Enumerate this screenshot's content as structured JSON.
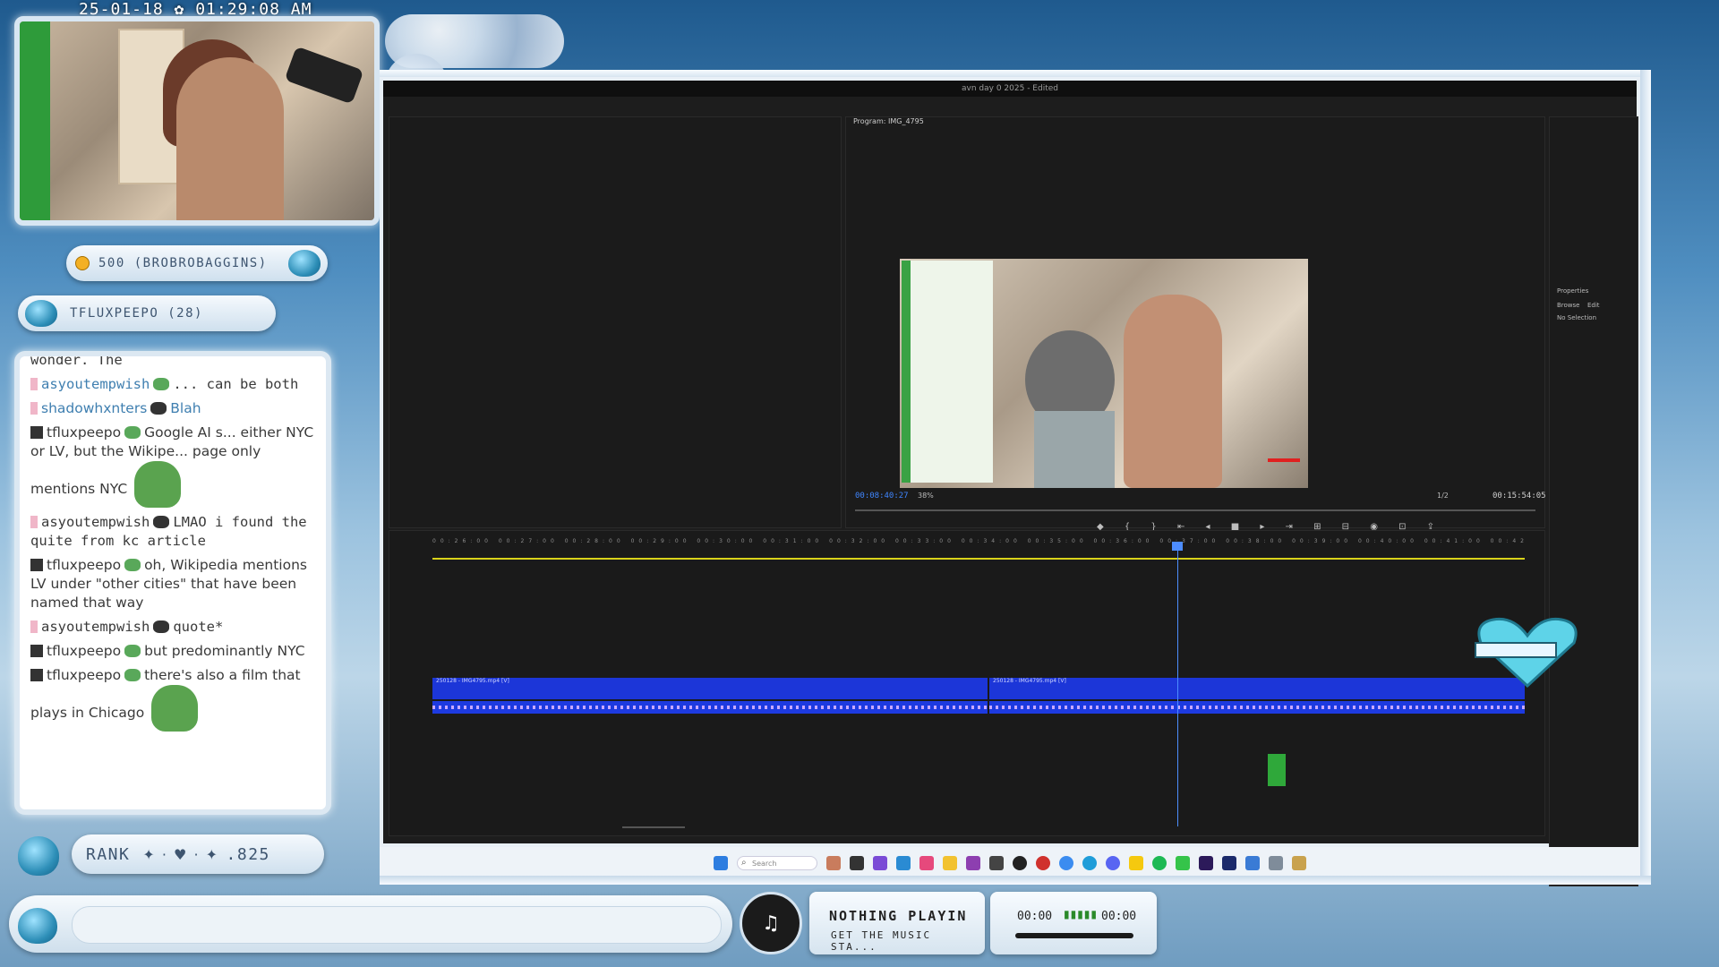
{
  "overlay": {
    "timestamp": "25-01-18 ✿ 01:29:08 AM",
    "alerts": [
      {
        "text": "500 (BROBROBAGGINS)"
      },
      {
        "text": "TFLUXPEEPO (28)"
      }
    ],
    "rank": {
      "label": "RANK",
      "value": ".825"
    }
  },
  "chat": {
    "messages": [
      {
        "user": "",
        "text": "wonder. The"
      },
      {
        "user": "asyoutempwish",
        "text": "... can be both"
      },
      {
        "user": "shadowhxnters",
        "text": "Blah"
      },
      {
        "user": "tfluxpeepo",
        "text": "Google AI s... either NYC or LV, but the Wikipe... page only mentions NYC"
      },
      {
        "user": "asyoutempwish",
        "text": "LMAO i found the quite from kc article"
      },
      {
        "user": "tfluxpeepo",
        "text": "oh, Wikipedia mentions LV under \"other cities\" that have been named that way"
      },
      {
        "user": "asyoutempwish",
        "text": "quote*"
      },
      {
        "user": "tfluxpeepo",
        "text": "but predominantly NYC"
      },
      {
        "user": "tfluxpeepo",
        "text": "there's also a film that plays in Chicago"
      }
    ]
  },
  "music": {
    "title": "NOTHING PLAYIN",
    "subtitle": "GET THE MUSIC STA...",
    "time_start": "00:00",
    "time_end": "00:00",
    "progress": 0
  },
  "premiere": {
    "title": "avn day 0 2025 - Edited",
    "program_label": "Program: IMG_4795",
    "timecode_current": "00:08:40:27",
    "timecode_total": "00:15:54:05",
    "zoom": "38%",
    "resolution": "1/2",
    "properties": {
      "title": "Properties",
      "tab_browse": "Browse",
      "tab_edit": "Edit",
      "empty": "No Selection"
    },
    "clip1": "250128 - IMG4795.mp4 [V]",
    "clip2": "250128 - IMG4795.mp4 [V]",
    "ruler": "00:26:00 00:27:00 00:28:00 00:29:00 00:30:00 00:31:00 00:32:00 00:33:00 00:34:00 00:35:00 00:36:00 00:37:00 00:38:00 00:39:00 00:40:00 00:41:00 00:42:00 00:43:00 00:44:00 00:45:00 00:46"
  },
  "taskbar": {
    "search_placeholder": "Search"
  }
}
